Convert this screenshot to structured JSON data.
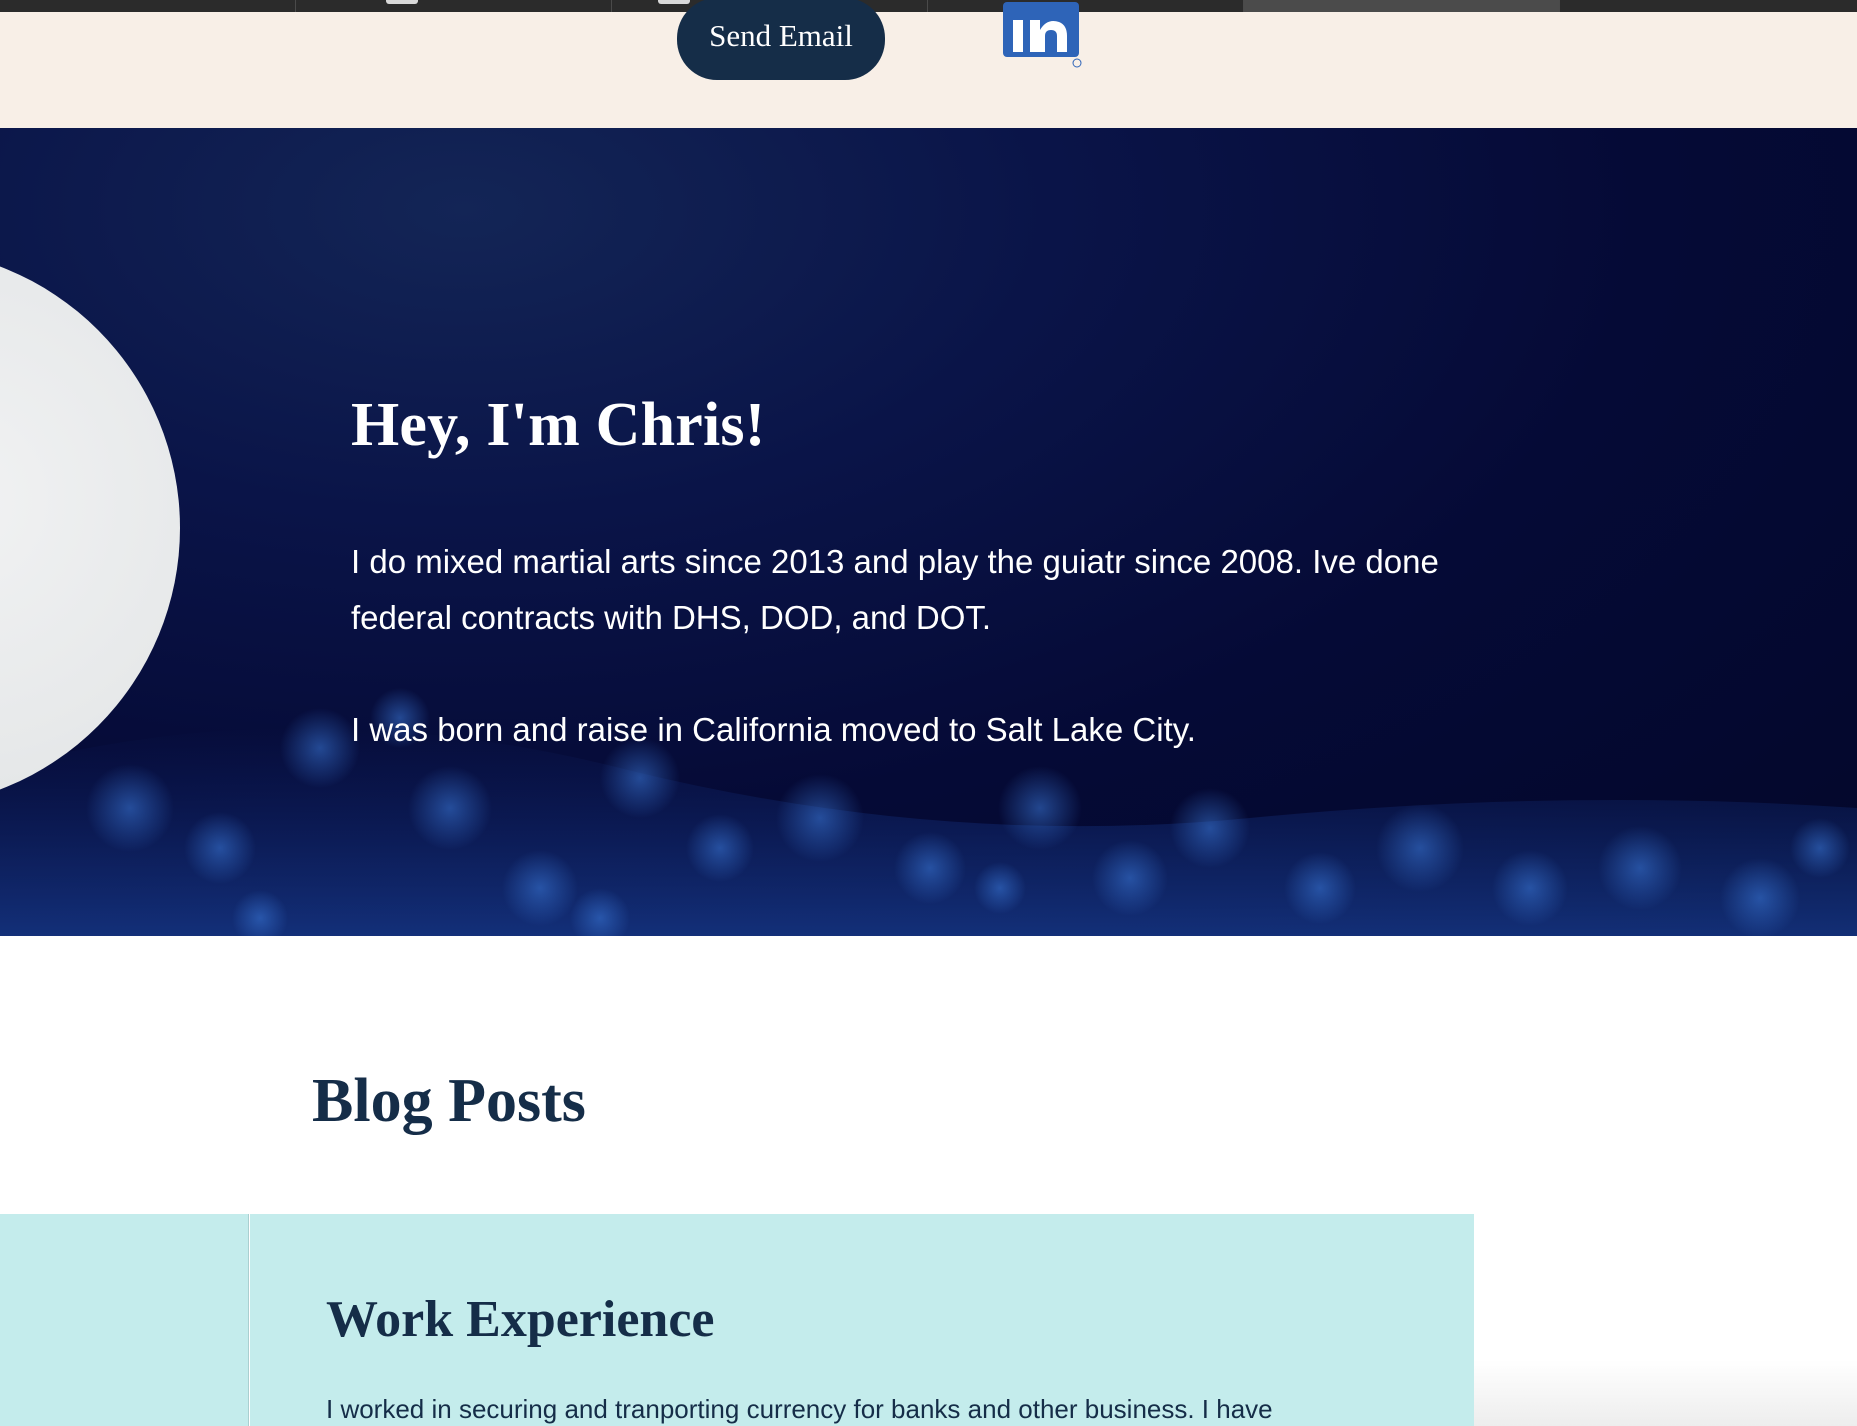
{
  "contact": {
    "send_email_label": "Send Email",
    "linkedin_text": "in"
  },
  "hero": {
    "title": "Hey, I'm Chris!",
    "paragraph1": "I do mixed martial arts since 2013 and play the guiatr since 2008. Ive done federal contracts with DHS, DOD, and DOT.",
    "paragraph2": "I was born and raise in California moved to Salt Lake City."
  },
  "blog": {
    "title": "Blog Posts",
    "posts": [
      {
        "title": "Work Experience",
        "excerpt": "I worked in securing and tranporting currency for banks and other business. I have"
      }
    ]
  },
  "colors": {
    "navy": "#152d48",
    "cream": "#f8efe7",
    "teal_card": "#c4ecec",
    "linkedin_blue": "#2e64b8",
    "hero_dark": "#050a36"
  },
  "icons": {
    "linkedin": "linkedin-icon"
  }
}
